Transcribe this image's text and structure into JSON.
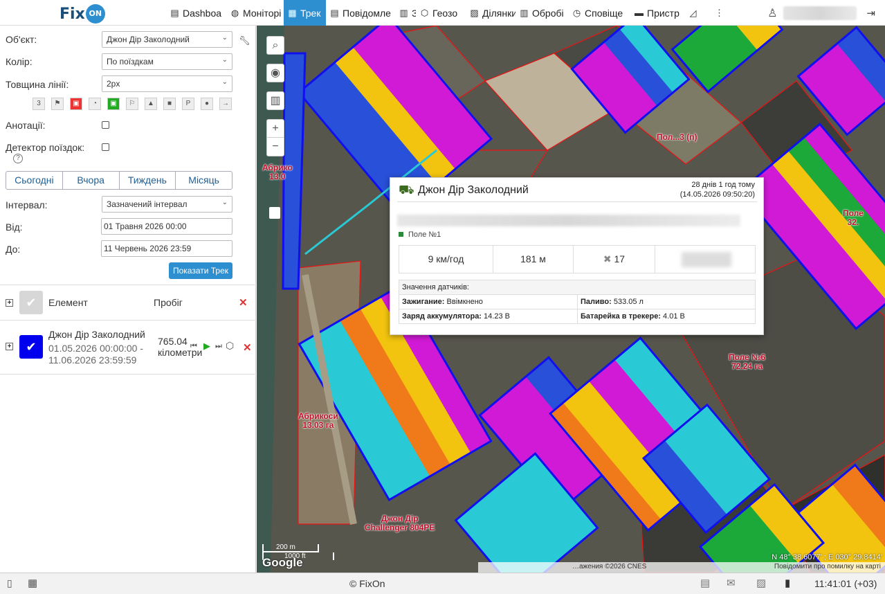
{
  "brand": {
    "logo_text": "Fix",
    "logo_badge": "ON"
  },
  "nav": [
    {
      "label": "Dashboa",
      "icon": "dashboard-icon",
      "glyph": "▤",
      "active": false,
      "w": 87
    },
    {
      "label": "Моніторі",
      "icon": "globe-icon",
      "glyph": "◍",
      "active": false,
      "w": 83
    },
    {
      "label": "Трек",
      "icon": "track-flag-icon",
      "glyph": "▦",
      "active": true,
      "w": 61
    },
    {
      "label": "Повідомле",
      "icon": "messages-icon",
      "glyph": "▤",
      "active": false,
      "w": 100
    },
    {
      "label": "Звіт",
      "icon": "report-icon",
      "glyph": "▥",
      "active": false,
      "w": 30
    },
    {
      "label": "Геозо",
      "icon": "geozone-icon",
      "glyph": "⬡",
      "active": false,
      "w": 72
    },
    {
      "label": "Ділянки",
      "icon": "fields-icon",
      "glyph": "▨",
      "active": false,
      "w": 72
    },
    {
      "label": "Обробі",
      "icon": "processing-icon",
      "glyph": "▥",
      "active": false,
      "w": 76
    },
    {
      "label": "Сповіще",
      "icon": "alarm-icon",
      "glyph": "◷",
      "active": false,
      "w": 90
    },
    {
      "label": "Пристр",
      "icon": "vehicle-icon",
      "glyph": "▬",
      "active": false,
      "w": 78
    },
    {
      "label": "",
      "icon": "ruler-icon",
      "glyph": "◿",
      "active": false,
      "w": 38
    },
    {
      "label": "",
      "icon": "more-icon",
      "glyph": "⋮",
      "active": false,
      "w": 28
    }
  ],
  "form": {
    "object_label": "Об'єкт:",
    "object_value": "Джон Дір Заколодний",
    "color_label": "Колір:",
    "color_value": "По поїздкам",
    "width_label": "Товщина лінії:",
    "width_value": "2px",
    "annotations_label": "Анотації:",
    "trip_detector_label": "Детектор поїздок:",
    "periods": [
      "Сьогодні",
      "Вчора",
      "Тиждень",
      "Місяць"
    ],
    "interval_label": "Інтервал:",
    "interval_value": "Зазначений інтервал",
    "from_label": "Від:",
    "from_value": "01 Травня 2026 00:00",
    "to_label": "До:",
    "to_value": "11 Червень 2026 23:59",
    "show_button": "Показати Трек"
  },
  "track_icons": [
    {
      "name": "counter-icon",
      "glyph": "3"
    },
    {
      "name": "flags-icon",
      "glyph": "⚑"
    },
    {
      "name": "fuel-red-icon",
      "glyph": "▣"
    },
    {
      "name": "speed-icon",
      "glyph": "◔"
    },
    {
      "name": "fuel-green-icon",
      "glyph": "▣"
    },
    {
      "name": "flag-icon",
      "glyph": "⚐"
    },
    {
      "name": "photo-icon",
      "glyph": "▲"
    },
    {
      "name": "video-icon",
      "glyph": "■"
    },
    {
      "name": "parking-icon",
      "glyph": "P"
    },
    {
      "name": "stop-icon",
      "glyph": "●"
    },
    {
      "name": "arrow-icon",
      "glyph": "→"
    }
  ],
  "list": {
    "header_element": "Елемент",
    "header_mileage": "Пробіг",
    "item_name": "Джон Дір Заколодний",
    "item_from": "01.05.2026 00:00:00 -",
    "item_to": "11.06.2026 23:59:59",
    "item_mileage": "765.04",
    "item_unit": "кілометри"
  },
  "popup": {
    "title": "Джон Дір Заколодний",
    "ago": "28 днів 1 год тому",
    "date": "(14.05.2026 09:50:20)",
    "geozone": "Поле №1",
    "speed": "9 км/год",
    "altitude": "181 м",
    "satellites": "17",
    "sensors_header": "Значення датчиків:",
    "sensors": [
      {
        "name": "Зажигание:",
        "value": "Ввімкнено"
      },
      {
        "name": "Паливо:",
        "value": "533.05 л"
      },
      {
        "name": "Заряд аккумулятора:",
        "value": "14.23 В"
      },
      {
        "name": "Батарейка в трекере:",
        "value": "4.01 В"
      }
    ]
  },
  "map_labels": [
    {
      "text": "Поле №6",
      "sub": "72.24 га"
    },
    {
      "text": "Абрикоси",
      "sub": "13.03 га"
    },
    {
      "text": "Поле",
      "sub": "32."
    },
    {
      "text": "Абрико",
      "sub": "13.0"
    },
    {
      "text": "Пол...3 (п)",
      "sub": ""
    },
    {
      "text": "Джон Дір",
      "sub": "Challenger 804PE"
    }
  ],
  "map": {
    "scale_m": "200 m",
    "scale_ft": "1000 ft",
    "google": "Google",
    "attribution": "…ажения ©2026 CNES",
    "report": "Повідомити про помилку на карті",
    "coords": "N 48° 38.6077' ; E 030° 29.8414'"
  },
  "footer": {
    "copyright": "© FixOn",
    "time": "11:41:01 (+03)"
  },
  "colors": {
    "accent": "#2e8fd0",
    "track_blue": "#1010ee",
    "field_border": "#ee1111"
  }
}
